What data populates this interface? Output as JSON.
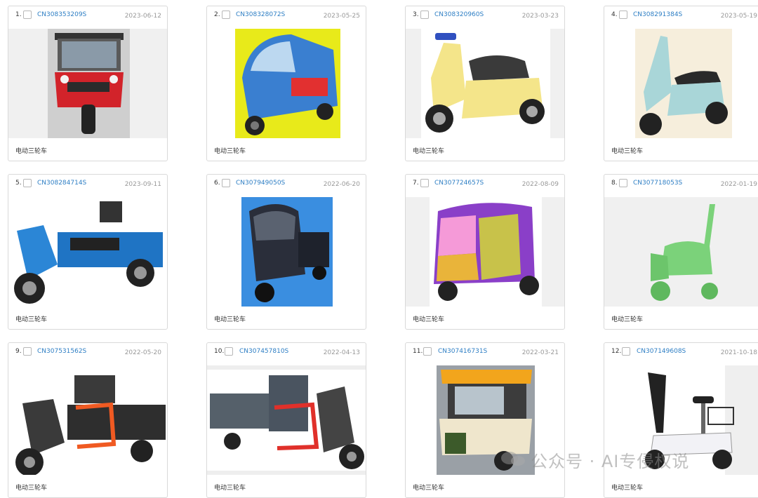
{
  "cards": [
    {
      "index": "1.",
      "patent_no": "CN308353209S",
      "date": "2023-06-12",
      "label": "电动三轮车"
    },
    {
      "index": "2.",
      "patent_no": "CN308328072S",
      "date": "2023-05-25",
      "label": "电动三轮车"
    },
    {
      "index": "3.",
      "patent_no": "CN308320960S",
      "date": "2023-03-23",
      "label": "电动三轮车"
    },
    {
      "index": "4.",
      "patent_no": "CN308291384S",
      "date": "2023-05-19",
      "label": "电动三轮车"
    },
    {
      "index": "5.",
      "patent_no": "CN308284714S",
      "date": "2023-09-11",
      "label": "电动三轮车"
    },
    {
      "index": "6.",
      "patent_no": "CN307949050S",
      "date": "2022-06-20",
      "label": "电动三轮车"
    },
    {
      "index": "7.",
      "patent_no": "CN307724657S",
      "date": "2022-08-09",
      "label": "电动三轮车"
    },
    {
      "index": "8.",
      "patent_no": "CN307718053S",
      "date": "2022-01-19",
      "label": "电动三轮车"
    },
    {
      "index": "9.",
      "patent_no": "CN307531562S",
      "date": "2022-05-20",
      "label": "电动三轮车"
    },
    {
      "index": "10.",
      "patent_no": "CN307457810S",
      "date": "2022-04-13",
      "label": "电动三轮车"
    },
    {
      "index": "11.",
      "patent_no": "CN307416731S",
      "date": "2022-03-21",
      "label": "电动三轮车"
    },
    {
      "index": "12.",
      "patent_no": "CN307149608S",
      "date": "2021-10-18",
      "label": "电动三轮车"
    }
  ],
  "watermark": {
    "text": "公众号 · AI专侵权说"
  },
  "colors": {
    "link": "#2d7ec4",
    "border": "#d9d9d9",
    "date": "#999999"
  }
}
